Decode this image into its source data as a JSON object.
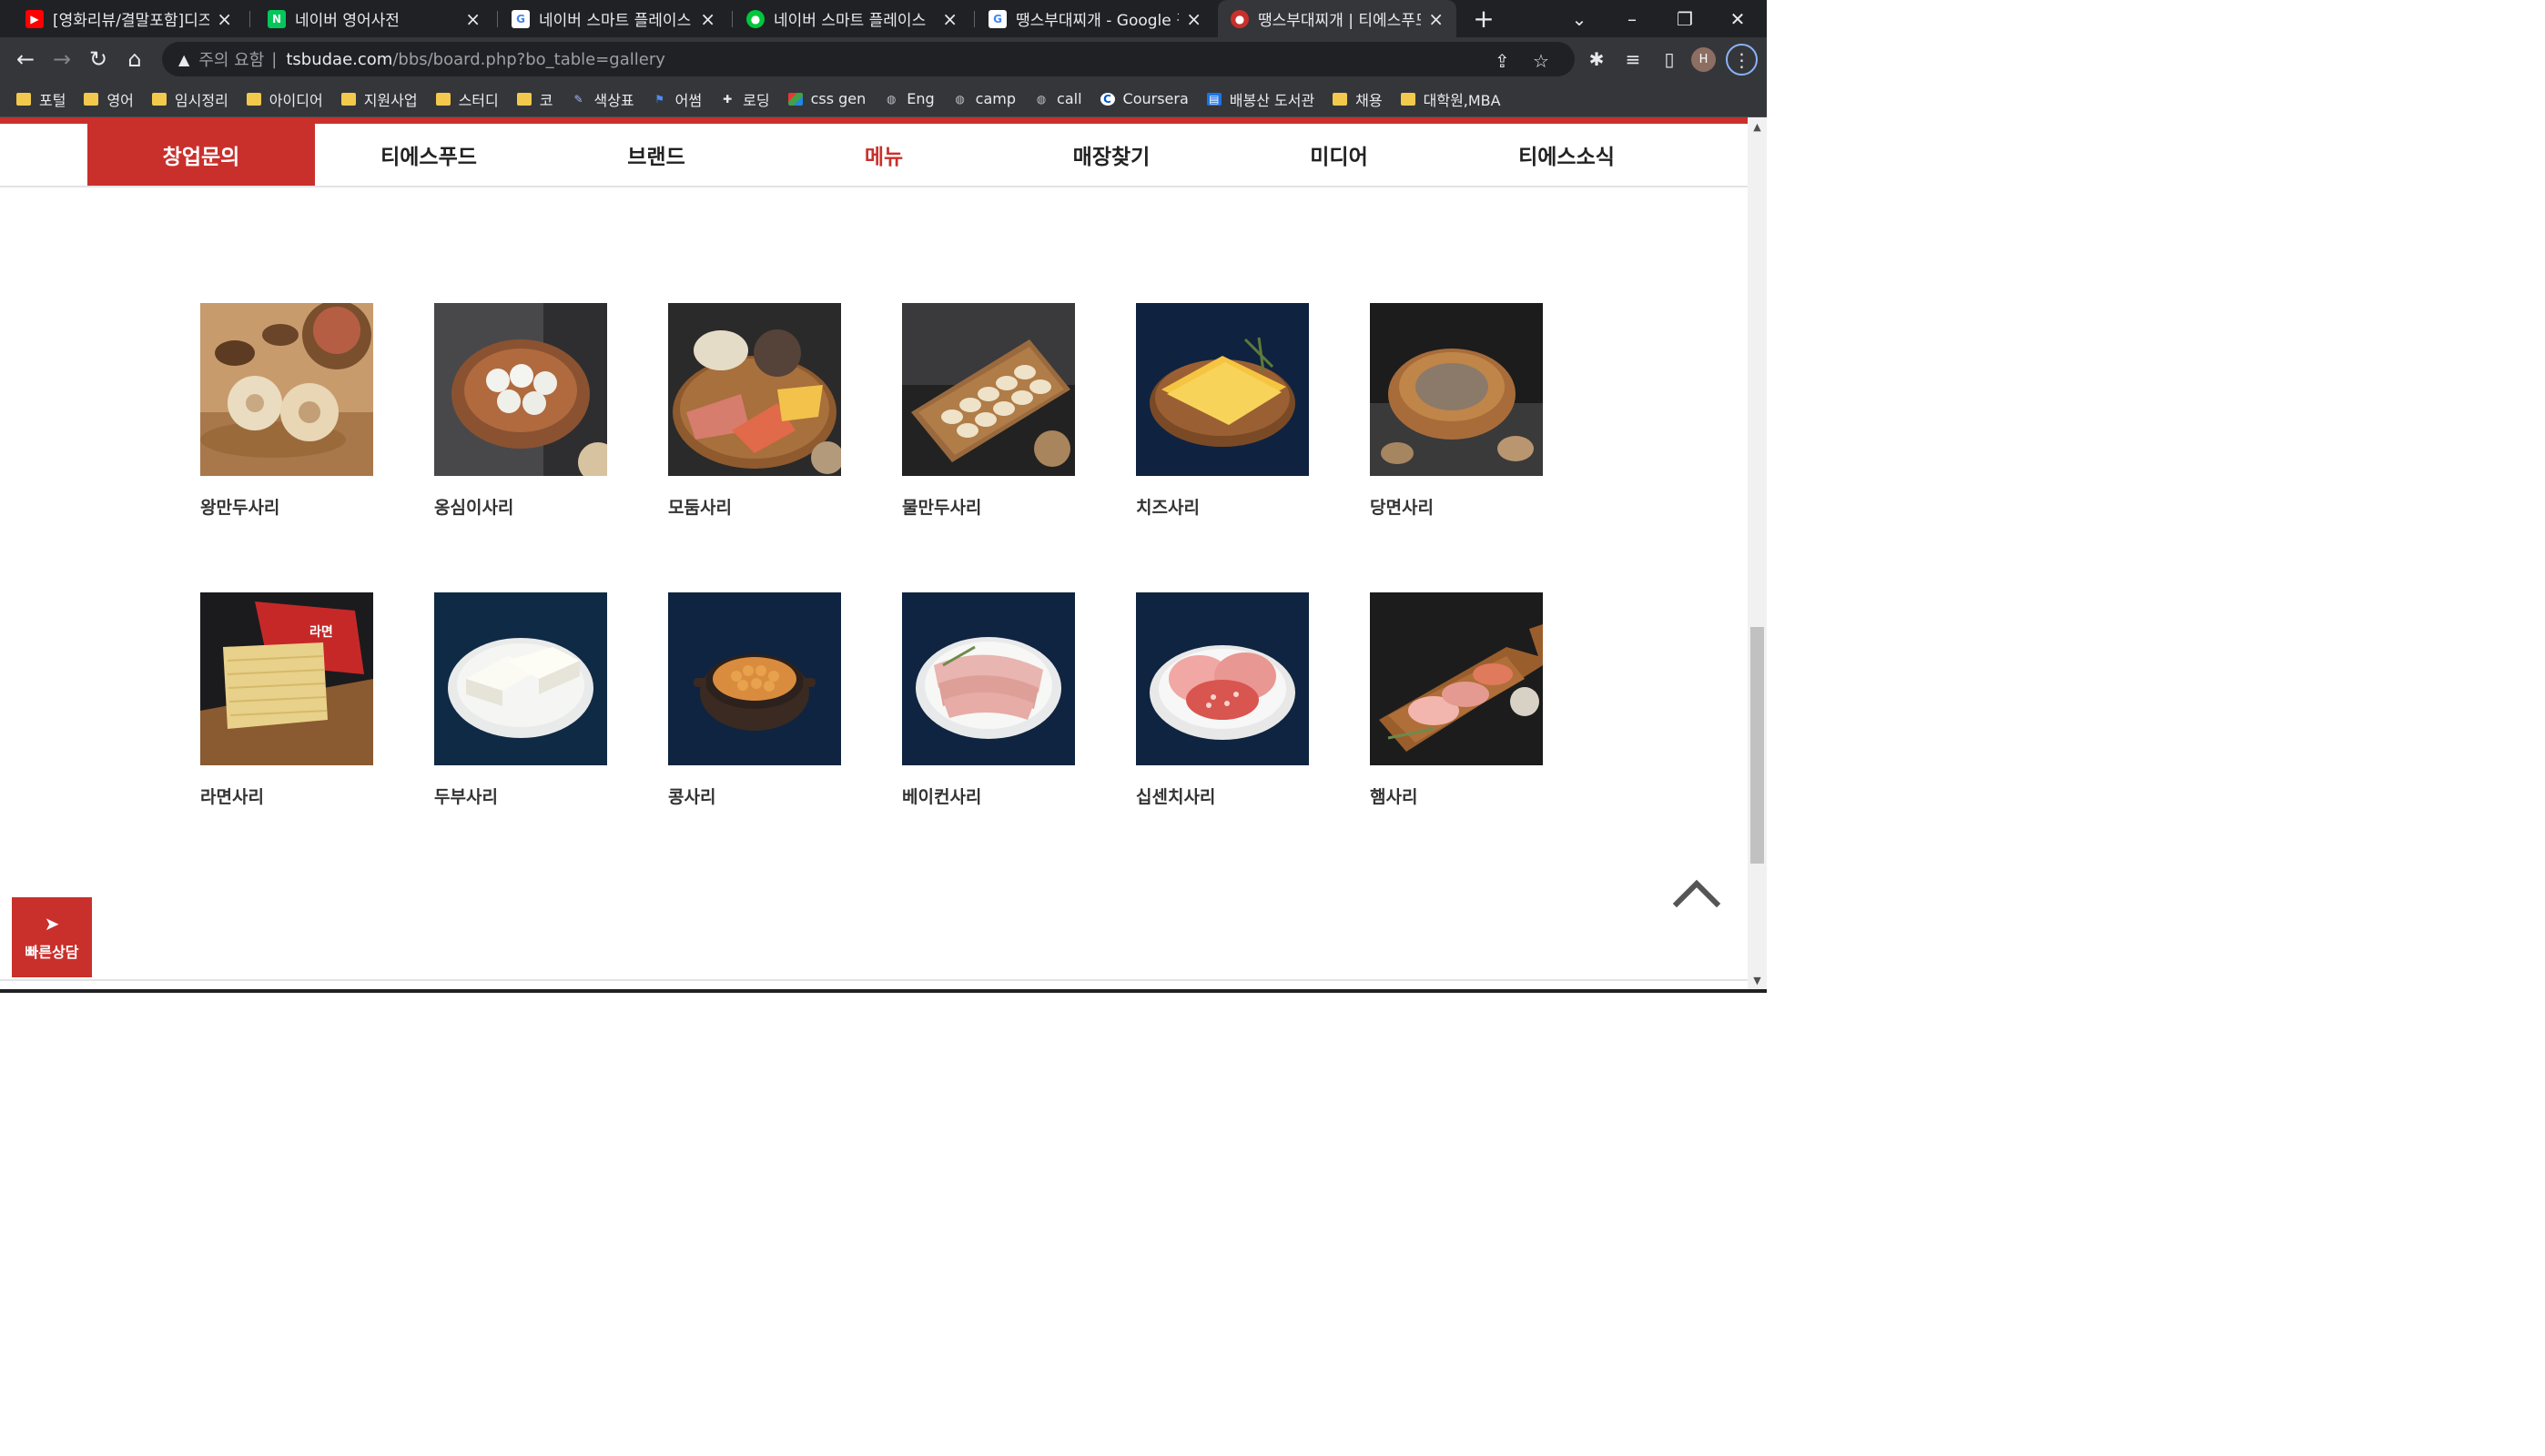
{
  "tabs": [
    {
      "title": "[영화리뷰/결말포함]디즈니",
      "favicon": "youtube-icon",
      "color": "#ff0000",
      "active": false
    },
    {
      "title": "네이버 영어사전",
      "favicon": "naver-dictionary-icon",
      "color": "#03c75a",
      "active": false
    },
    {
      "title": "네이버 스마트 플레이스 - Go",
      "favicon": "google-icon",
      "color": "#4285f4",
      "active": false
    },
    {
      "title": "네이버 스마트 플레이스",
      "favicon": "smart-place-icon",
      "color": "#00c73c",
      "active": false
    },
    {
      "title": "땡스부대찌개 - Google 검",
      "favicon": "google-icon",
      "color": "#4285f4",
      "active": false
    },
    {
      "title": "땡스부대찌개 | 티에스푸드",
      "favicon": "site-icon",
      "color": "#c9302c",
      "active": true
    }
  ],
  "url": {
    "warning": "주의 요함",
    "separator": "|",
    "host": "tsbudae.com",
    "path": "/bbs/board.php?bo_table=gallery"
  },
  "profile": {
    "initial": "H"
  },
  "bookmarks": [
    {
      "label": "포털",
      "icon": "folder-icon"
    },
    {
      "label": "영어",
      "icon": "folder-icon"
    },
    {
      "label": "임시정리",
      "icon": "folder-icon"
    },
    {
      "label": "아이디어",
      "icon": "folder-icon"
    },
    {
      "label": "지원사업",
      "icon": "folder-icon"
    },
    {
      "label": "스터디",
      "icon": "folder-icon"
    },
    {
      "label": "코",
      "icon": "folder-icon"
    },
    {
      "label": "색상표",
      "icon": "palette-icon"
    },
    {
      "label": "어썸",
      "icon": "flag-icon"
    },
    {
      "label": "로딩",
      "icon": "loading-icon"
    },
    {
      "label": "css gen",
      "icon": "css-icon"
    },
    {
      "label": "Eng",
      "icon": "globe-icon"
    },
    {
      "label": "camp",
      "icon": "globe-icon"
    },
    {
      "label": "call",
      "icon": "globe-icon"
    },
    {
      "label": "Coursera",
      "icon": "coursera-icon"
    },
    {
      "label": "배봉산 도서관",
      "icon": "library-icon"
    },
    {
      "label": "채용",
      "icon": "folder-icon"
    },
    {
      "label": "대학원,MBA",
      "icon": "folder-icon"
    }
  ],
  "site_nav": [
    {
      "label": "창업문의",
      "state": "cta"
    },
    {
      "label": "티에스푸드",
      "state": ""
    },
    {
      "label": "브랜드",
      "state": ""
    },
    {
      "label": "메뉴",
      "state": "current"
    },
    {
      "label": "매장찾기",
      "state": ""
    },
    {
      "label": "미디어",
      "state": ""
    },
    {
      "label": "티에스소식",
      "state": ""
    }
  ],
  "menu_items": [
    {
      "name": "왕만두사리",
      "image": "king-dumpling-photo"
    },
    {
      "name": "옹심이사리",
      "image": "ongsimi-photo"
    },
    {
      "name": "모둠사리",
      "image": "assorted-photo"
    },
    {
      "name": "물만두사리",
      "image": "water-dumpling-photo"
    },
    {
      "name": "치즈사리",
      "image": "cheese-photo"
    },
    {
      "name": "당면사리",
      "image": "glass-noodle-photo"
    },
    {
      "name": "라면사리",
      "image": "ramen-photo"
    },
    {
      "name": "두부사리",
      "image": "tofu-photo"
    },
    {
      "name": "콩사리",
      "image": "bean-photo"
    },
    {
      "name": "베이컨사리",
      "image": "bacon-photo"
    },
    {
      "name": "십센치사리",
      "image": "ten-cm-ham-photo"
    },
    {
      "name": "햄사리",
      "image": "ham-photo"
    }
  ],
  "quick_consult": {
    "label": "빠른상담",
    "icon": "paper-plane-icon"
  },
  "colors": {
    "brand_red": "#c9302c",
    "chrome_dark": "#202124",
    "chrome_toolbar": "#35363a"
  }
}
